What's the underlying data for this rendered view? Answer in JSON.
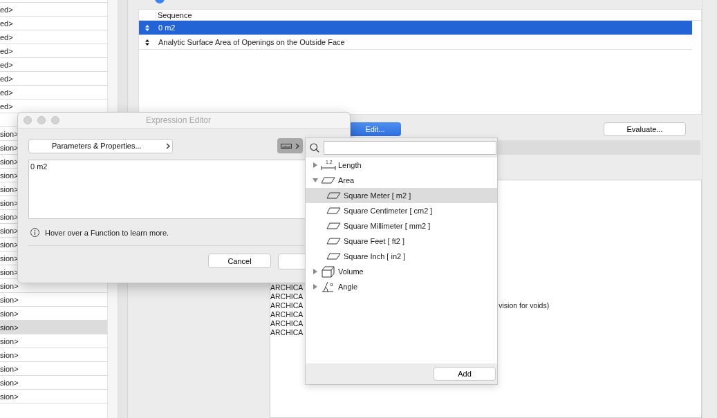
{
  "left_list": {
    "top_rows": [
      {
        "text": "ed>",
        "selected": false
      },
      {
        "text": "ed>",
        "selected": false
      },
      {
        "text": "ed>",
        "selected": false
      },
      {
        "text": "ed>",
        "selected": false
      },
      {
        "text": "ed>",
        "selected": false
      },
      {
        "text": "ed>",
        "selected": false
      },
      {
        "text": "ed>",
        "selected": false
      },
      {
        "text": "ed>",
        "selected": false
      }
    ],
    "bottom_rows": [
      {
        "text": "sion>",
        "selected": false
      },
      {
        "text": "sion>",
        "selected": false
      },
      {
        "text": "sion>",
        "selected": false
      },
      {
        "text": "sion>",
        "selected": false
      },
      {
        "text": "sion>",
        "selected": false
      },
      {
        "text": "sion>",
        "selected": false
      },
      {
        "text": "sion>",
        "selected": false
      },
      {
        "text": "sion>",
        "selected": false
      },
      {
        "text": "sion>",
        "selected": false
      },
      {
        "text": "sion>",
        "selected": false
      },
      {
        "text": "sion>",
        "selected": false
      },
      {
        "text": "sion>",
        "selected": false
      },
      {
        "text": "sion>",
        "selected": false
      },
      {
        "text": "sion>",
        "selected": false
      },
      {
        "text": "sion>",
        "selected": true
      },
      {
        "text": "sion>",
        "selected": false
      },
      {
        "text": "sion>",
        "selected": false
      },
      {
        "text": "sion>",
        "selected": false
      },
      {
        "text": "sion>",
        "selected": false
      },
      {
        "text": "sion>",
        "selected": false
      }
    ]
  },
  "sequence_table": {
    "column": "Sequence",
    "rows": [
      {
        "text": "0 m2",
        "selected": true
      },
      {
        "text": "Analytic Surface Area of Openings on the Outside Face",
        "selected": false
      }
    ]
  },
  "edit_button": "Edit...",
  "evaluate_button": "Evaluate...",
  "output_lines": [
    {
      "text": "ARCHICA"
    },
    {
      "text": "ARCHICA"
    },
    {
      "text": "ARCHICA",
      "tail": "vision for voids)"
    },
    {
      "text": "ARCHICA"
    },
    {
      "text": "ARCHICA"
    },
    {
      "text": "ARCHICA"
    }
  ],
  "dialog": {
    "title": "Expression Editor",
    "parameters_button": "Parameters & Properties...",
    "expression": "0 m2",
    "hint": "Hover over a Function to learn more.",
    "buttons": [
      "Cancel"
    ]
  },
  "unit_popover": {
    "tree": [
      {
        "label": "Length",
        "kind": "length",
        "icon_text": "1.2",
        "expanded": false,
        "selected": false
      },
      {
        "label": "Area",
        "kind": "area",
        "expanded": true,
        "selected": false,
        "children": [
          {
            "label": "Square Meter  [ m2 ]",
            "kind": "area",
            "selected": true
          },
          {
            "label": "Square Centimeter  [ cm2 ]",
            "kind": "area",
            "selected": false
          },
          {
            "label": "Square Millimeter  [ mm2 ]",
            "kind": "area",
            "selected": false
          },
          {
            "label": "Square Feet  [ ft2 ]",
            "kind": "area",
            "selected": false
          },
          {
            "label": "Square Inch  [ in2 ]",
            "kind": "area",
            "selected": false
          }
        ]
      },
      {
        "label": "Volume",
        "kind": "volume",
        "expanded": false,
        "selected": false
      },
      {
        "label": "Angle",
        "kind": "angle",
        "icon_text": "α",
        "expanded": false,
        "selected": false
      }
    ],
    "add_button": "Add"
  }
}
